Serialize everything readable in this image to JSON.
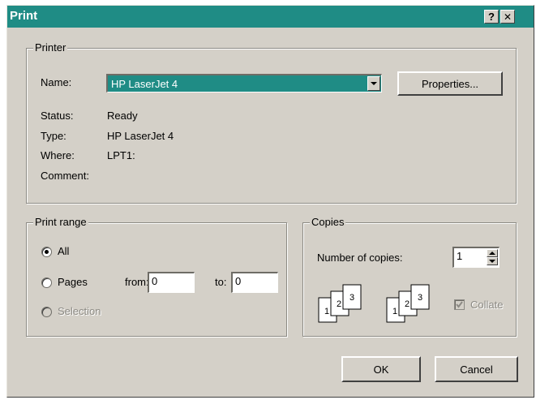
{
  "window": {
    "title": "Print",
    "help_glyph": "?",
    "close_glyph": "✕"
  },
  "printer": {
    "legend": "Printer",
    "name_label": "Name:",
    "name_value": "HP LaserJet 4",
    "properties_label": "Properties...",
    "status_label": "Status:",
    "status_value": "Ready",
    "type_label": "Type:",
    "type_value": "HP LaserJet 4",
    "where_label": "Where:",
    "where_value": "LPT1:",
    "comment_label": "Comment:"
  },
  "print_range": {
    "legend": "Print range",
    "all_label": "All",
    "pages_label": "Pages",
    "from_label": "from:",
    "from_value": "0",
    "to_label": "to:",
    "to_value": "0",
    "selection_label": "Selection",
    "selected": "all"
  },
  "copies": {
    "legend": "Copies",
    "number_label": "Number of copies:",
    "number_value": "1",
    "collate_label": "Collate",
    "collate_checked": true
  },
  "actions": {
    "ok_label": "OK",
    "cancel_label": "Cancel"
  },
  "colors": {
    "title_bar": "#1f8c85",
    "face": "#d4d0c8"
  }
}
